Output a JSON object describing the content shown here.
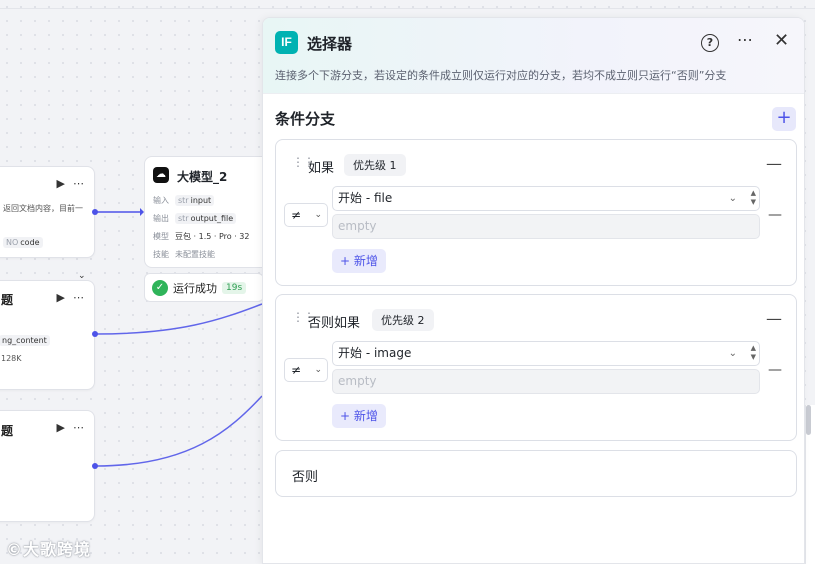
{
  "canvas": {
    "node_top": {
      "snippet": "返回文档内容，目前一",
      "tag_prefix": "NO",
      "tag_value": "code"
    },
    "node_mid": {
      "title_fragment": "题",
      "tag_value": "ng_content",
      "size": "128K"
    },
    "node_bottom": {
      "title_fragment": "题"
    },
    "llm_node": {
      "title": "大模型_2",
      "input_label": "输入",
      "input_prefix": "str",
      "input_value": "input",
      "output_label": "输出",
      "output_prefix": "str",
      "output_value": "output_file",
      "model_label": "模型",
      "model_value": "豆包 · 1.5 · Pro · 32",
      "skill_label": "技能",
      "skill_value": "未配置技能"
    },
    "run_status": {
      "text": "运行成功",
      "duration": "19s"
    },
    "watermark": "大歌跨境"
  },
  "panel": {
    "icon_text": "IF",
    "title": "选择器",
    "description": "连接多个下游分支，若设定的条件成立则仅运行对应的分支，若均不成立则只运行“否则”分支",
    "section_title": "条件分支",
    "add_symbol": "+",
    "branches": [
      {
        "label": "如果",
        "priority": "优先级 1",
        "operator": "≠",
        "variable": "开始 - file",
        "value_placeholder": "empty",
        "add_label": "+ 新增"
      },
      {
        "label": "否则如果",
        "priority": "优先级 2",
        "operator": "≠",
        "variable": "开始 - image",
        "value_placeholder": "empty",
        "add_label": "+ 新增"
      }
    ],
    "else_label": "否则"
  },
  "colors": {
    "accent": "#4d53e8",
    "if_icon": "#00b2b2",
    "success": "#2fb45a"
  }
}
